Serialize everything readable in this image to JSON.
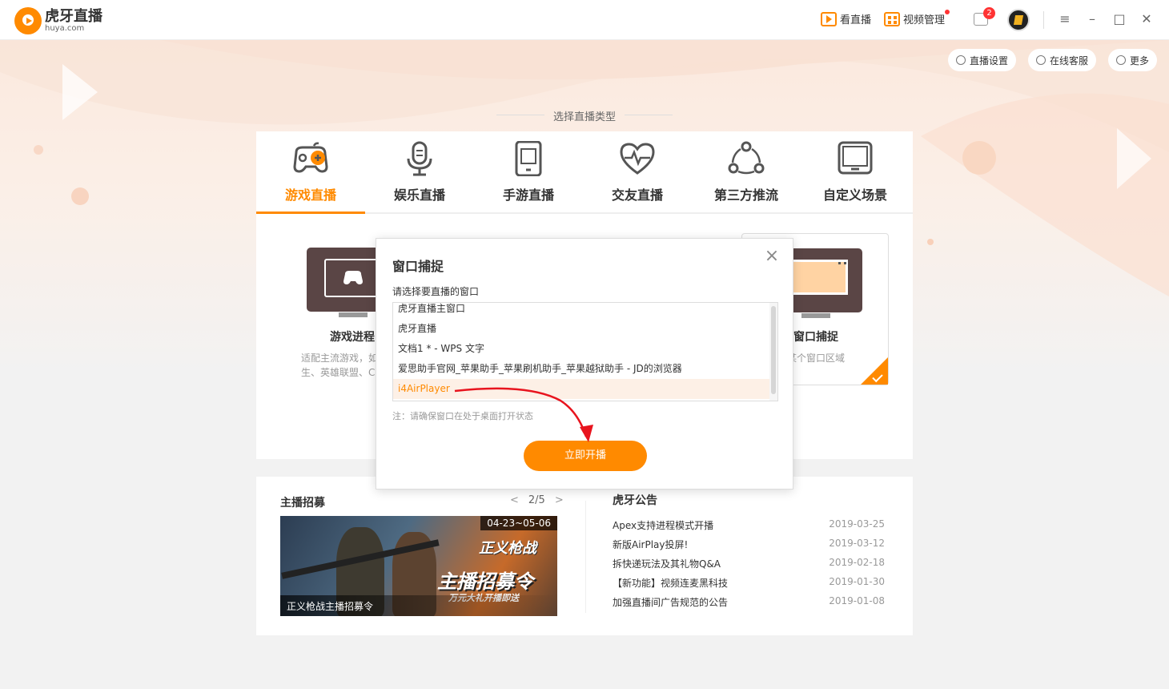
{
  "app": {
    "logo_cn": "虎牙直播",
    "logo_en": "huya.com"
  },
  "titlebar": {
    "watch_live": "看直播",
    "video_manage": "视频管理",
    "message_count": "2",
    "icons": [
      "play-icon",
      "video-grid-icon",
      "message-icon",
      "menu-icon",
      "minimize-icon",
      "maximize-icon",
      "close-icon"
    ]
  },
  "toolbar": {
    "live_settings": "直播设置",
    "online_support": "在线客服",
    "more": "更多"
  },
  "type_section_label": "选择直播类型",
  "tabs": [
    {
      "label": "游戏直播",
      "icon": "gamepad-icon",
      "active": true
    },
    {
      "label": "娱乐直播",
      "icon": "microphone-icon",
      "active": false
    },
    {
      "label": "手游直播",
      "icon": "tablet-icon",
      "active": false
    },
    {
      "label": "交友直播",
      "icon": "heart-pulse-icon",
      "active": false
    },
    {
      "label": "第三方推流",
      "icon": "share-nodes-icon",
      "active": false
    },
    {
      "label": "自定义场景",
      "icon": "monitor-icon",
      "active": false
    }
  ],
  "modes": {
    "game_process": {
      "name": "游戏进程",
      "desc_line1": "适配主流游戏，如",
      "desc_line2": "生、英雄联盟、C"
    },
    "window_capture": {
      "name": "窗口捕捉",
      "desc": "某个窗口区域"
    }
  },
  "recruit": {
    "title": "主播招募",
    "pager": "2/5",
    "banner_date": "04-23~05-06",
    "banner_logo": "正义枪战",
    "banner_title": "主播招募令",
    "banner_sub": "万元大礼开播即送",
    "banner_caption": "正义枪战主播招募令"
  },
  "announcements": {
    "title": "虎牙公告",
    "items": [
      {
        "text": "Apex支持进程模式开播",
        "date": "2019-03-25"
      },
      {
        "text": "新版AirPlay投屏!",
        "date": "2019-03-12"
      },
      {
        "text": "拆快递玩法及其礼物Q&A",
        "date": "2019-02-18"
      },
      {
        "text": "【新功能】视频连麦黑科技",
        "date": "2019-01-30"
      },
      {
        "text": "加强直播间广告规范的公告",
        "date": "2019-01-08"
      }
    ]
  },
  "dialog": {
    "title": "窗口捕捉",
    "prompt": "请选择要直播的窗口",
    "windows": [
      "虎牙直播主窗口",
      "虎牙直播",
      "文档1 * - WPS 文字",
      "爱思助手官网_苹果助手_苹果刷机助手_苹果越狱助手 - JD的浏览器",
      "i4AirPlayer"
    ],
    "selected_index": 4,
    "note": "注：请确保窗口在处于桌面打开状态",
    "start_button": "立即开播"
  },
  "colors": {
    "accent": "#ff8a00",
    "annotation_arrow": "#e8141e"
  }
}
